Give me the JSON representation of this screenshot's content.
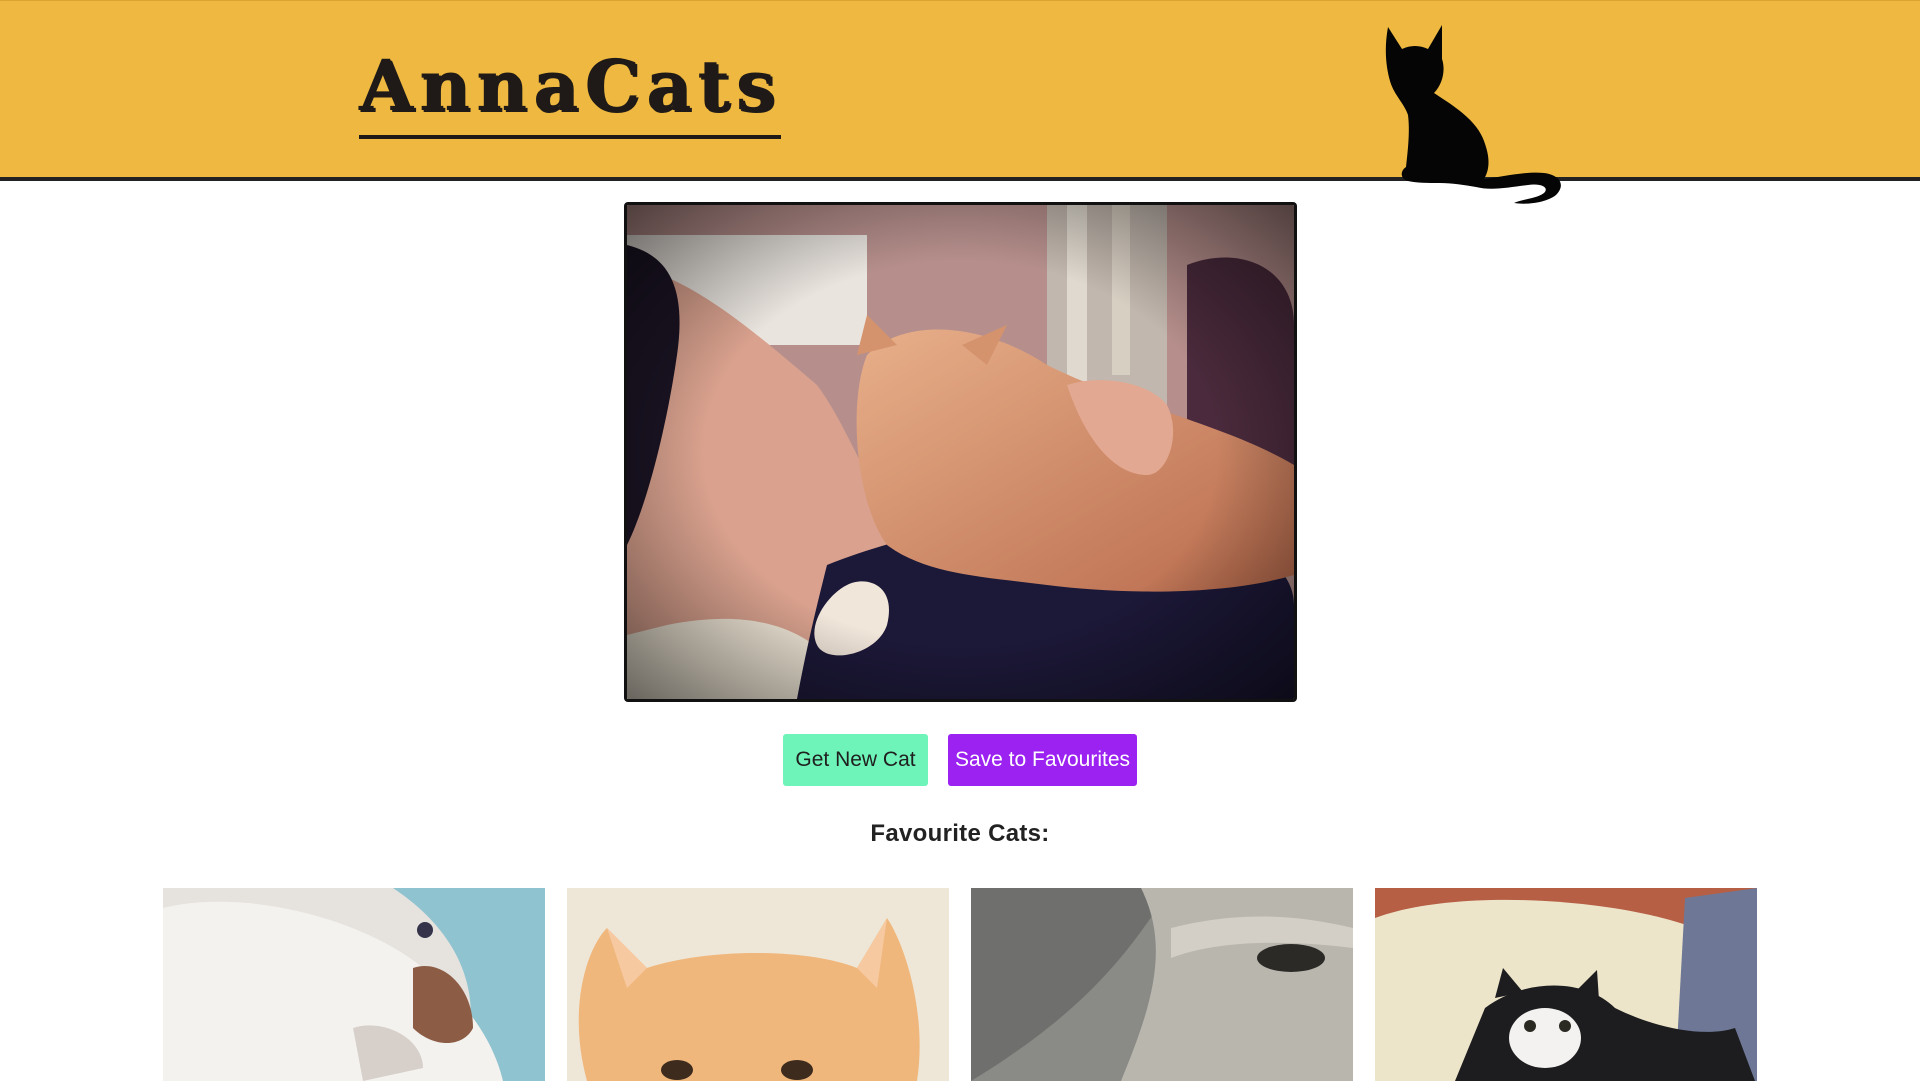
{
  "header": {
    "logo_text": "AnnaCats",
    "background": "#efb941",
    "silhouette_icon": "cat-silhouette-icon"
  },
  "main_photo": {
    "alt": "Man sleeping with orange tabby cat"
  },
  "buttons": {
    "get_new_cat": "Get New Cat",
    "save_to_favourites": "Save to Favourites"
  },
  "favourites": {
    "title": "Favourite Cats:",
    "items": [
      {
        "alt": "White cat sleeping on blue blanket"
      },
      {
        "alt": "Orange kitten close-up"
      },
      {
        "alt": "Grey tabby cat in the rain"
      },
      {
        "alt": "Black and white cat on bed"
      }
    ]
  },
  "colors": {
    "header_yellow": "#efb941",
    "button_green": "#6ef4b9",
    "button_purple": "#9b22f0"
  }
}
